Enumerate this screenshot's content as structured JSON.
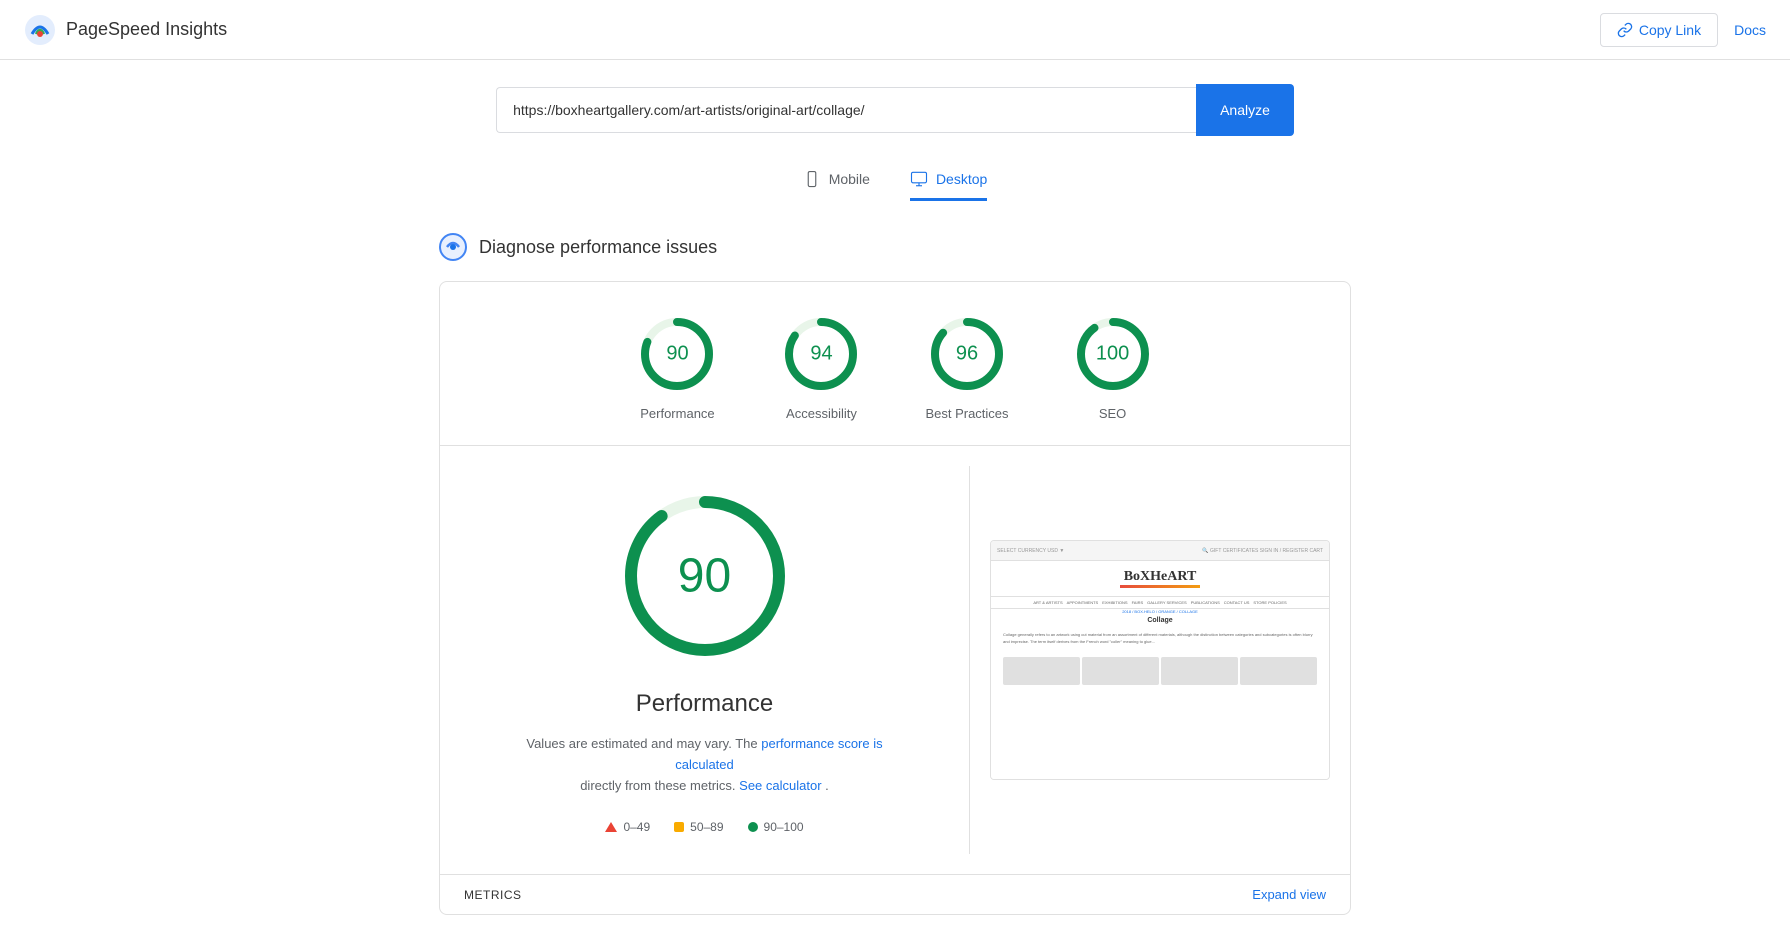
{
  "app": {
    "title": "PageSpeed Insights"
  },
  "header": {
    "copy_link_label": "Copy Link",
    "docs_label": "Docs"
  },
  "search": {
    "url_value": "https://boxheartgallery.com/art-artists/original-art/collage/",
    "url_placeholder": "Enter a web page URL",
    "analyze_label": "Analyze"
  },
  "mode_tabs": {
    "mobile_label": "Mobile",
    "desktop_label": "Desktop",
    "active": "desktop"
  },
  "diagnose": {
    "title": "Diagnose performance issues"
  },
  "scores": [
    {
      "id": "performance",
      "label": "Performance",
      "value": 90,
      "percent": 90
    },
    {
      "id": "accessibility",
      "label": "Accessibility",
      "value": 94,
      "percent": 94
    },
    {
      "id": "best-practices",
      "label": "Best Practices",
      "value": 96,
      "percent": 96
    },
    {
      "id": "seo",
      "label": "SEO",
      "value": 100,
      "percent": 100
    }
  ],
  "detail": {
    "score": 90,
    "title": "Performance",
    "description_1": "Values are estimated and may vary. The",
    "link_1_label": "performance score is calculated",
    "description_2": "directly from these metrics.",
    "link_2_label": "See calculator",
    "description_3": "."
  },
  "legend": {
    "items": [
      {
        "id": "red",
        "range": "0–49"
      },
      {
        "id": "orange",
        "range": "50–89"
      },
      {
        "id": "green",
        "range": "90–100"
      }
    ]
  },
  "bottom": {
    "metrics_label": "METRICS",
    "expand_label": "Expand view"
  }
}
